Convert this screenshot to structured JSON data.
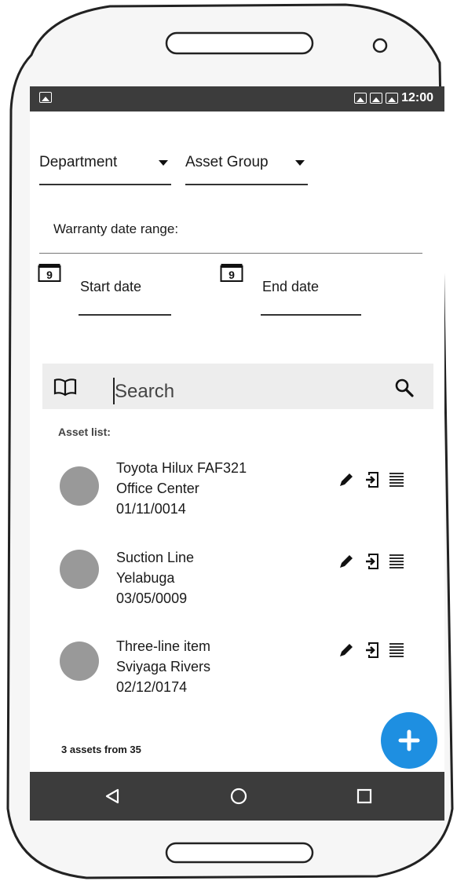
{
  "status_bar": {
    "time": "12:00"
  },
  "filters": {
    "department": "Department",
    "asset_group": "Asset Group",
    "warranty_label": "Warranty date range:",
    "calendar_day": "9",
    "start_date": "Start date",
    "end_date": "End date"
  },
  "search": {
    "placeholder": "Search"
  },
  "list": {
    "title": "Asset list:",
    "items": [
      {
        "name": "Toyota Hilux FAF321",
        "location": "Office Center",
        "date": "01/11/0014"
      },
      {
        "name": "Suction Line",
        "location": "Yelabuga",
        "date": "03/05/0009"
      },
      {
        "name": "Three-line item",
        "location": "Sviyaga Rivers",
        "date": "02/12/0174"
      }
    ]
  },
  "footer": {
    "count_text": "3 assets from 35"
  },
  "colors": {
    "accent": "#1e8fe1",
    "bar": "#3c3c3c",
    "avatar": "#999999"
  },
  "icons": [
    "book-icon",
    "search-icon",
    "edit-icon",
    "export-icon",
    "menu-lines-icon",
    "calendar-icon",
    "plus-icon",
    "back-icon",
    "home-icon",
    "recents-icon"
  ]
}
